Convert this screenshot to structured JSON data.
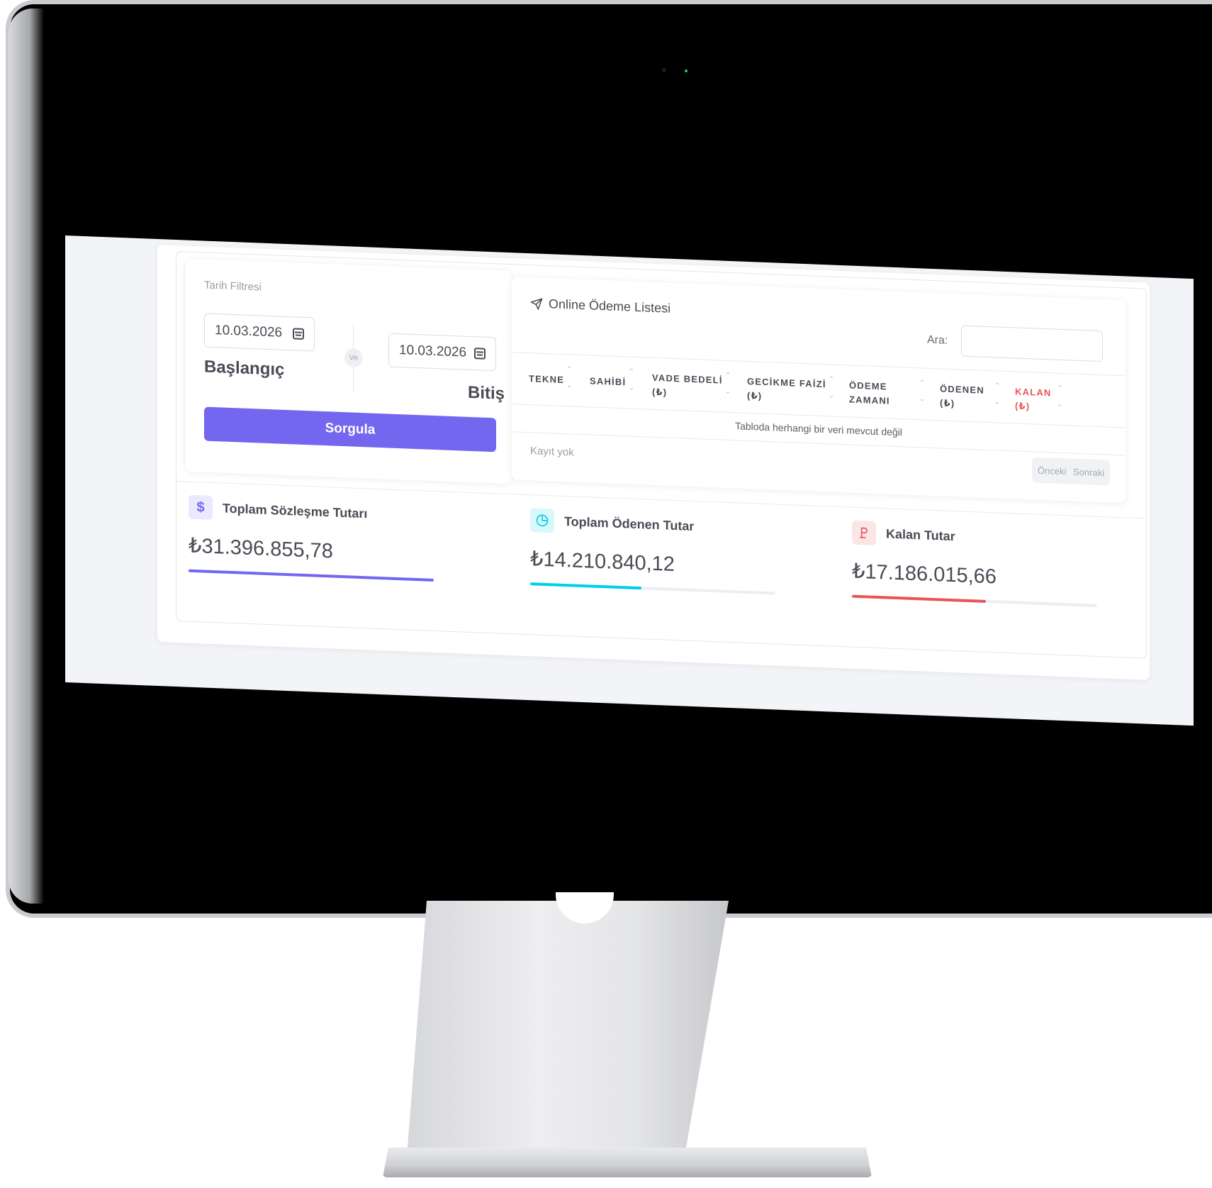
{
  "filter": {
    "title": "Tarih Filtresi",
    "start_date": "10.03.2026",
    "end_date": "10.03.2026",
    "separator": "Ve",
    "start_label": "Başlangıç",
    "end_label": "Bitiş",
    "submit_label": "Sorgula"
  },
  "payments": {
    "title": "Online Ödeme Listesi",
    "search_label": "Ara:",
    "search_value": "",
    "columns": [
      {
        "line1": "TEKNE",
        "line2": ""
      },
      {
        "line1": "SAHİBİ",
        "line2": ""
      },
      {
        "line1": "VADE BEDELİ",
        "line2": "(₺)"
      },
      {
        "line1": "GECİKME FAİZİ",
        "line2": "(₺)"
      },
      {
        "line1": "ÖDEME",
        "line2": "ZAMANI"
      },
      {
        "line1": "ÖDENEN",
        "line2": "(₺)"
      },
      {
        "line1": "KALAN",
        "line2": "(₺)"
      }
    ],
    "empty_message": "Tabloda herhangi bir veri mevcut değil",
    "info": "Kayıt yok",
    "prev_label": "Önceki",
    "next_label": "Sonraki"
  },
  "stats": [
    {
      "label": "Toplam Sözleşme Tutarı",
      "value": "₺31.396.855,78",
      "icon": "dollar-icon",
      "color": "#7367f0",
      "progress": 1.0
    },
    {
      "label": "Toplam Ödenen Tutar",
      "value": "₺14.210.840,12",
      "icon": "pie-chart-icon",
      "color": "#00cfe8",
      "progress": 0.453
    },
    {
      "label": "Kalan Tutar",
      "value": "₺17.186.015,66",
      "icon": "lira-icon",
      "color": "#ea5455",
      "progress": 0.547
    }
  ],
  "colors": {
    "primary": "#7367f0",
    "info": "#00cfe8",
    "danger": "#ea5455"
  }
}
